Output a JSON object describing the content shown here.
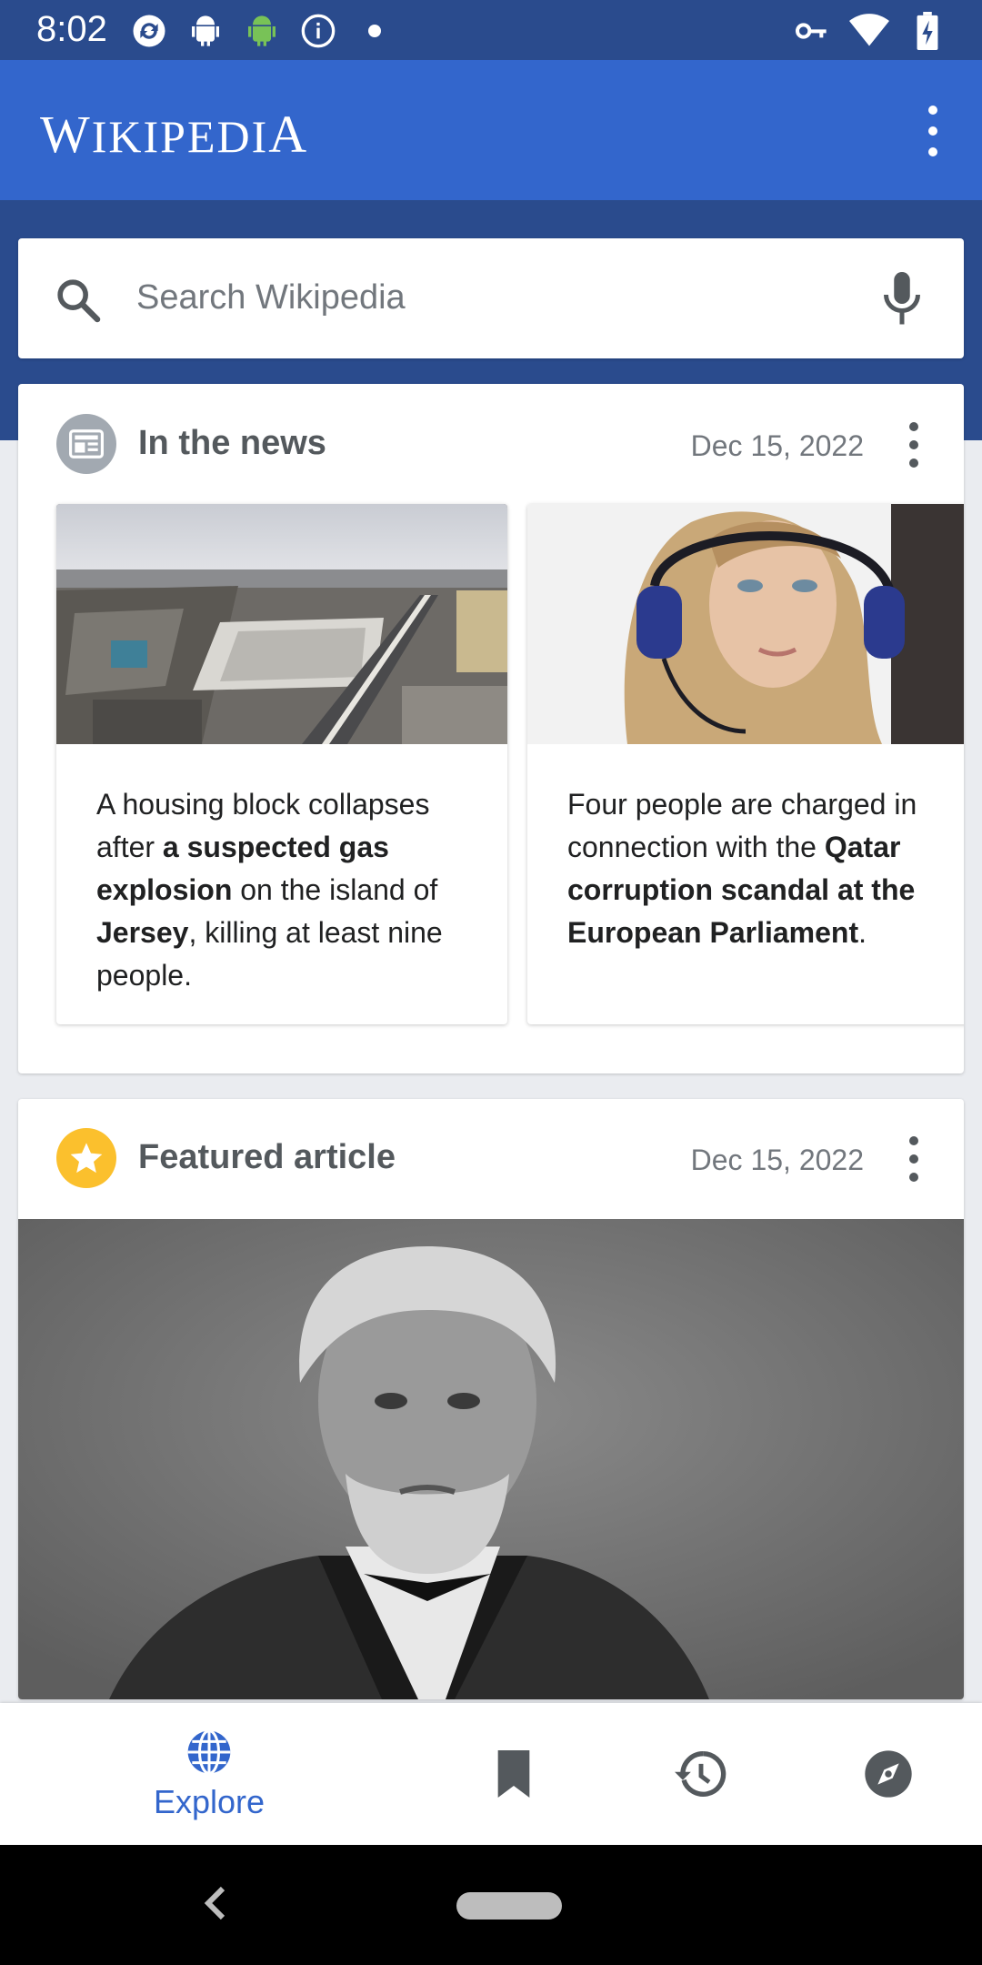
{
  "status_bar": {
    "time": "8:02",
    "left_icons": [
      "sync-icon",
      "android-robot-icon",
      "android-green-icon",
      "info-icon",
      "dot-icon"
    ],
    "right_icons": [
      "vpn-key-icon",
      "wifi-icon",
      "battery-charging-icon"
    ]
  },
  "app_bar": {
    "title_first": "W",
    "title_mid": "IKIPEDI",
    "title_last": "A",
    "overflow_icon": "more-vert-icon"
  },
  "search": {
    "placeholder": "Search Wikipedia",
    "icon": "search-icon",
    "voice_icon": "mic-icon"
  },
  "news_card": {
    "title": "In the news",
    "date": "Dec 15, 2022",
    "icon": "newspaper-icon",
    "items": [
      {
        "parts": [
          "A housing block collapses after ",
          "a suspected gas explosion",
          " on the island of ",
          "Jersey",
          ", killing at least nine people."
        ]
      },
      {
        "parts": [
          "Four people are charged in connection with the ",
          "Qatar corruption scandal at the European Parliament",
          "."
        ]
      }
    ]
  },
  "featured_card": {
    "title": "Featured article",
    "date": "Dec 15, 2022",
    "icon": "star-icon"
  },
  "bottom_nav": {
    "explore_label": "Explore",
    "items": [
      "globe-icon",
      "bookmark-icon",
      "history-icon",
      "compass-icon"
    ]
  },
  "colors": {
    "status_bar": "#2a4b8d",
    "app_bar": "#3366cc",
    "accent": "#3366cc",
    "star": "#fbc02d",
    "news_icon_bg": "#a2a9b1"
  }
}
